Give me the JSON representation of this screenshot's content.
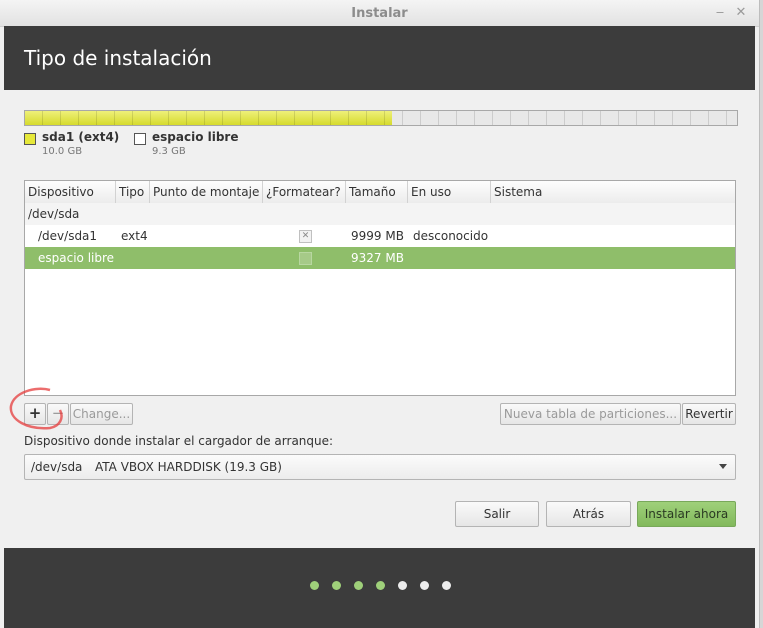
{
  "window": {
    "title": "Instalar",
    "minimize_icon": "minimize-icon",
    "close_icon": "close-icon"
  },
  "header": {
    "title": "Tipo de instalación"
  },
  "disk_bar": {
    "used_fraction": 0.516,
    "used_color": "#d6db2d",
    "free_color": "#e8e8e8"
  },
  "legend": [
    {
      "name": "sda1 (ext4)",
      "size": "10.0 GB",
      "color": "#e6e83a"
    },
    {
      "name": "espacio libre",
      "size": "9.3 GB",
      "color": "#ffffff"
    }
  ],
  "table": {
    "columns": [
      "Dispositivo",
      "Tipo",
      "Punto de montaje",
      "¿Formatear?",
      "Tamaño",
      "En uso",
      "Sistema"
    ],
    "rows": [
      {
        "device": "/dev/sda",
        "type": "",
        "mount": "",
        "format": null,
        "size": "",
        "used": "",
        "system": ""
      },
      {
        "device": "/dev/sda1",
        "type": "ext4",
        "mount": "",
        "format": "checked",
        "size": "9999 MB",
        "used": "desconocido",
        "system": ""
      },
      {
        "device": "espacio libre",
        "type": "",
        "mount": "",
        "format": "unchecked",
        "size": "9327 MB",
        "used": "",
        "system": "",
        "selected": true
      }
    ]
  },
  "partition_toolbar": {
    "add": "+",
    "remove": "−",
    "change": "Change...",
    "new_table": "Nueva tabla de particiones...",
    "revert": "Revertir"
  },
  "bootloader": {
    "label": "Dispositivo donde instalar el cargador de arranque:",
    "device": "/dev/sda",
    "description": "ATA VBOX HARDDISK (19.3 GB)"
  },
  "actions": {
    "quit": "Salir",
    "back": "Atrás",
    "install": "Instalar ahora",
    "accent": "#8bc265"
  },
  "progress": {
    "total_steps": 7,
    "completed_steps": 4
  }
}
